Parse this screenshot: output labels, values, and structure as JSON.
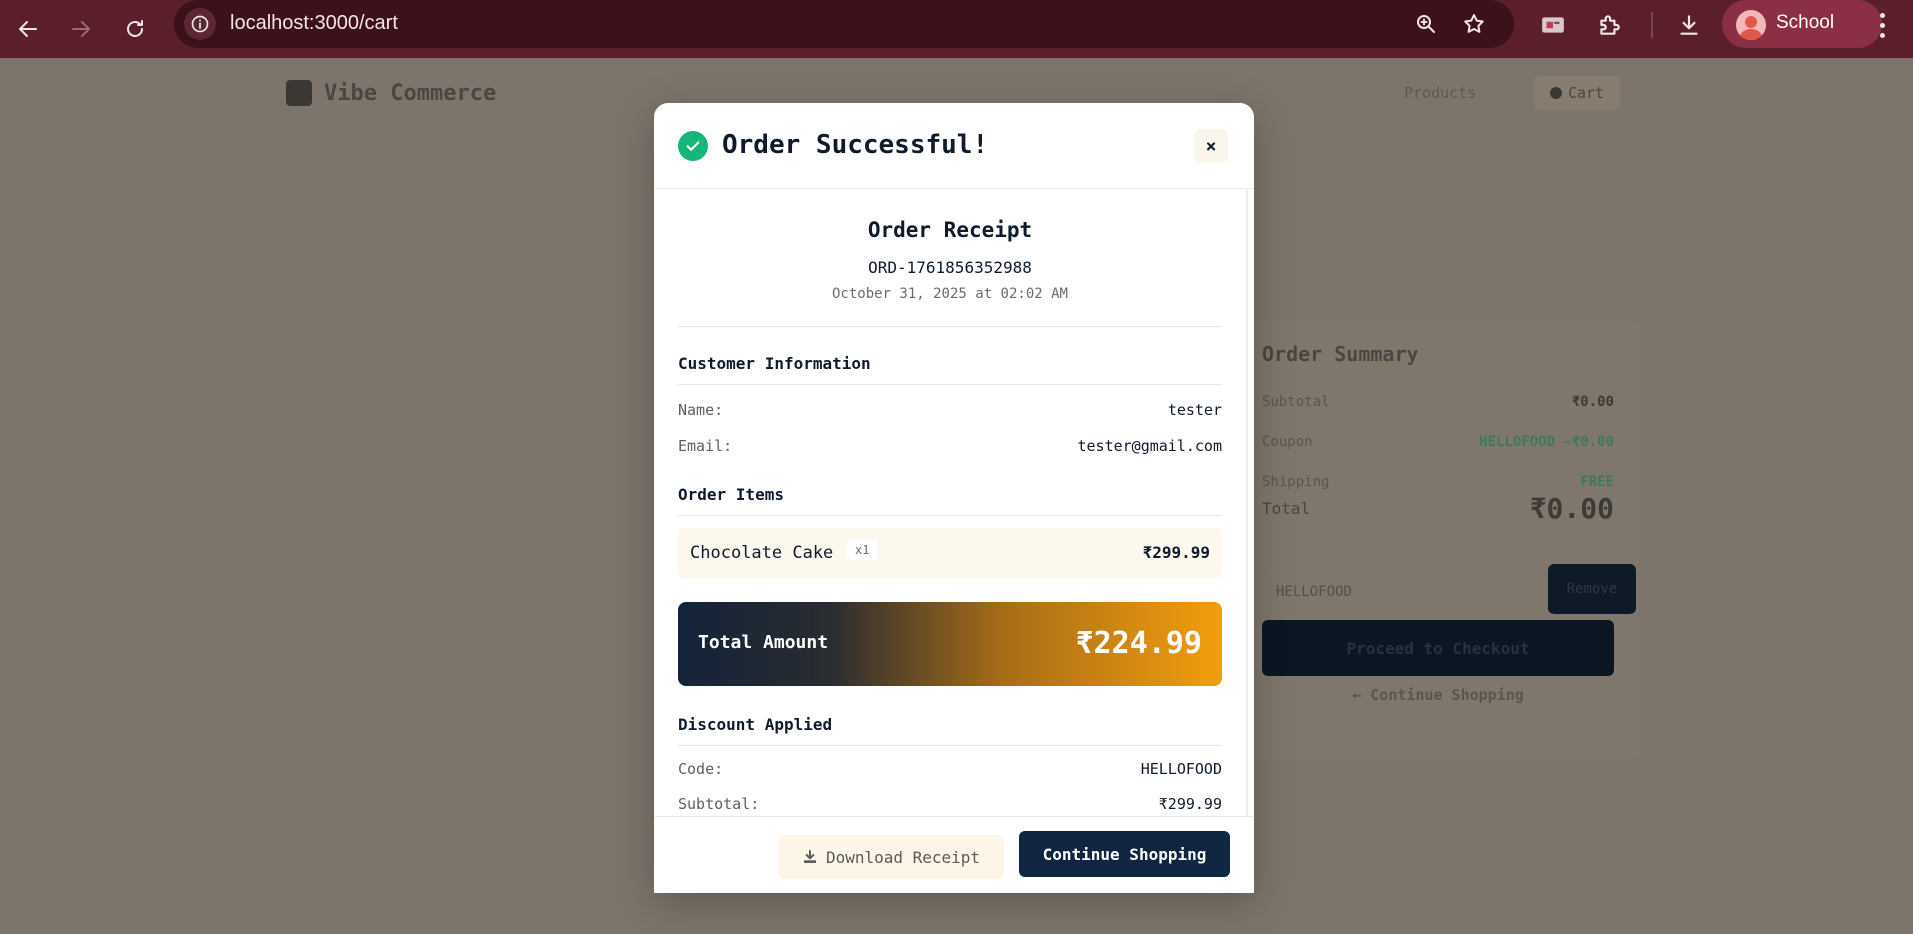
{
  "browser": {
    "url": "localhost:3000/cart",
    "profile_name": "School",
    "icons": [
      "back-arrow-icon",
      "forward-arrow-icon",
      "reload-icon",
      "site-info-icon",
      "zoom-icon",
      "bookmark-star-icon",
      "extension-card-icon",
      "extensions-puzzle-icon",
      "download-icon",
      "menu-dots-icon"
    ]
  },
  "background_page": {
    "logo": "Vibe Commerce",
    "nav_products": "Products",
    "nav_cart": "Cart",
    "summary": {
      "title": "Order Summary",
      "rows": [
        {
          "label": "Subtotal",
          "value": "₹0.00"
        },
        {
          "label": "Coupon",
          "value": "HELLOFOOD -₹0.00"
        },
        {
          "label": "Shipping",
          "value": "FREE"
        }
      ],
      "total_label": "Total",
      "total_value": "₹0.00",
      "coupon_value": "HELLOFOOD",
      "remove_label": "Remove",
      "checkout_label": "Proceed to Checkout",
      "continue_label": "← Continue Shopping"
    }
  },
  "modal": {
    "title": "Order Successful!",
    "close_label": "×",
    "receipt_title": "Order Receipt",
    "order_id": "ORD-1761856352988",
    "order_date": "October 31, 2025 at 02:02 AM",
    "customer_section": "Customer Information",
    "name_label": "Name:",
    "name_value": "tester",
    "email_label": "Email:",
    "email_value": "tester@gmail.com",
    "items_section": "Order Items",
    "items": [
      {
        "name": "Chocolate Cake",
        "qty": "x1",
        "price": "₹299.99"
      }
    ],
    "total_label": "Total Amount",
    "total_value": "₹224.99",
    "discount_section": "Discount Applied",
    "code_label": "Code:",
    "code_value": "HELLOFOOD",
    "subtotal_label": "Subtotal:",
    "subtotal_value": "₹299.99",
    "download_label": "Download Receipt",
    "continue_label": "Continue Shopping"
  },
  "colors": {
    "chrome_bg": "#5a1f2a",
    "success_green": "#16b57a",
    "navy": "#0f2540",
    "amber": "#f29e0d"
  }
}
